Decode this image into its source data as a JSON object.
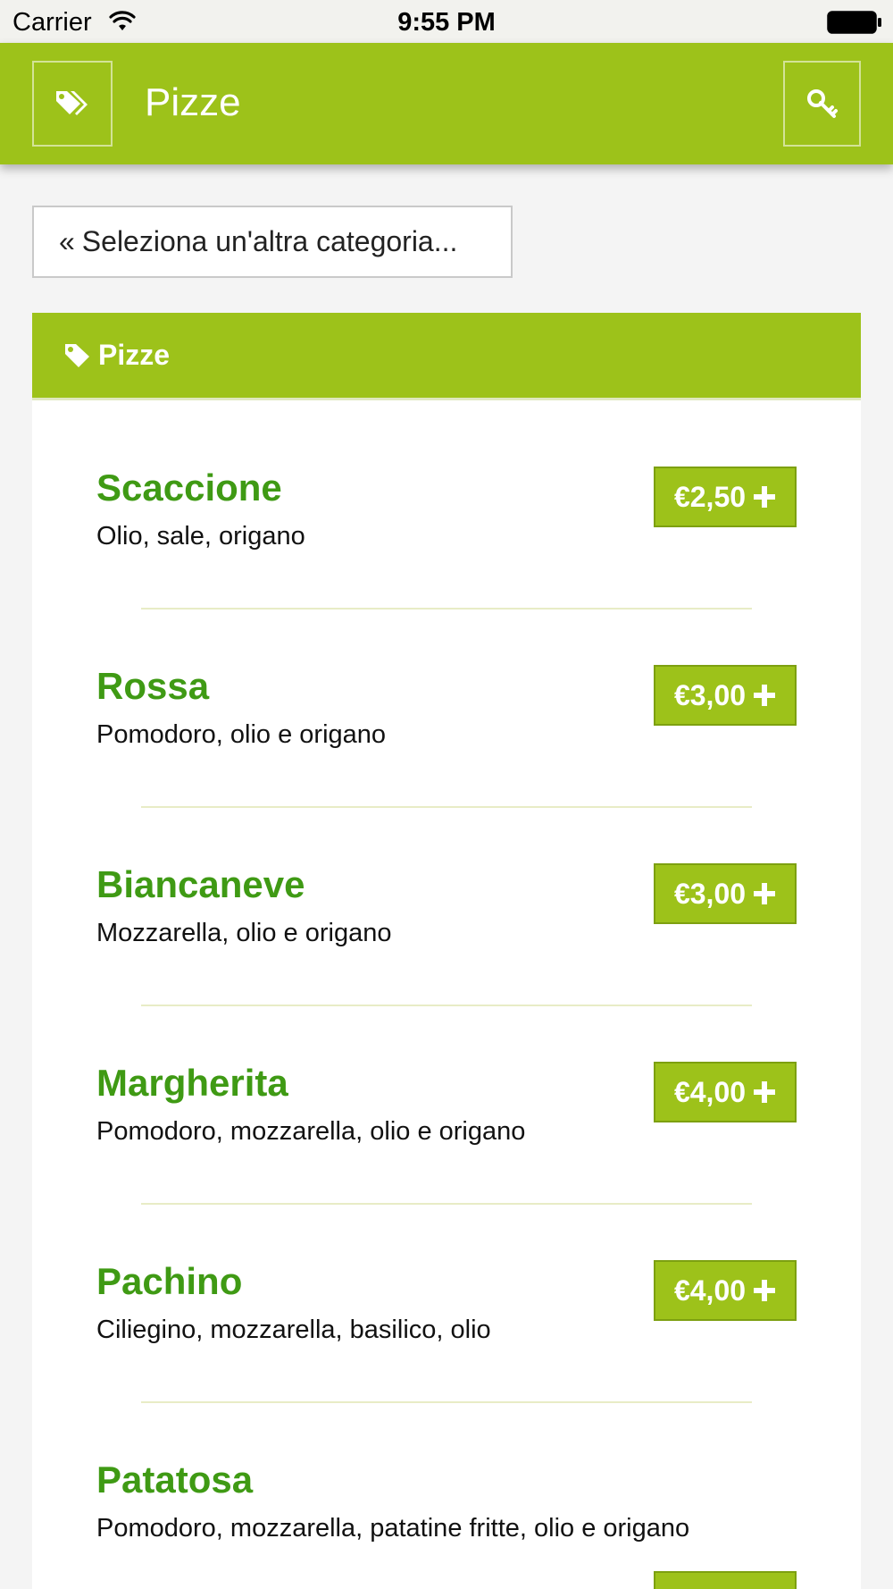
{
  "status_bar": {
    "carrier": "Carrier",
    "time": "9:55 PM"
  },
  "header": {
    "title": "Pizze",
    "left_icon": "tags-icon",
    "right_icon": "key-icon",
    "bar_color": "#9dc21a"
  },
  "back_button": {
    "chevron": "«",
    "label": "Seleziona un'altra categoria..."
  },
  "category": {
    "title": "Pizze",
    "icon": "tag-icon"
  },
  "colors": {
    "accent": "#9dc21a",
    "item_name": "#3f9a14"
  },
  "items": [
    {
      "name": "Scaccione",
      "description": "Olio, sale, origano",
      "price": "€2,50"
    },
    {
      "name": "Rossa",
      "description": "Pomodoro, olio e origano",
      "price": "€3,00"
    },
    {
      "name": "Biancaneve",
      "description": "Mozzarella, olio e origano",
      "price": "€3,00"
    },
    {
      "name": "Margherita",
      "description": "Pomodoro, mozzarella, olio e origano",
      "price": "€4,00"
    },
    {
      "name": "Pachino",
      "description": "Ciliegino, mozzarella, basilico, olio",
      "price": "€4,00"
    },
    {
      "name": "Patatosa",
      "description": "Pomodoro, mozzarella, patatine fritte, olio e origano",
      "price": ""
    }
  ]
}
